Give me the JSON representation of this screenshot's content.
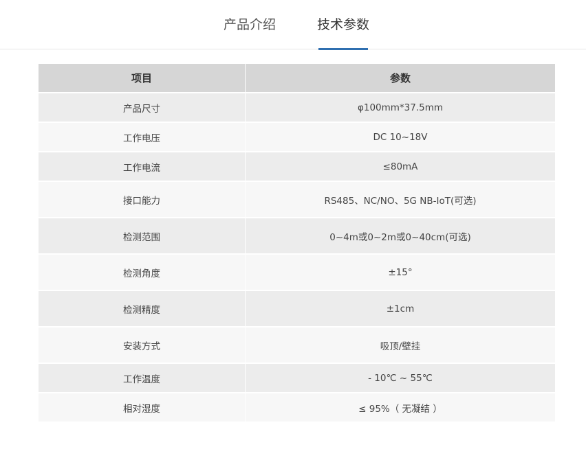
{
  "tabs": [
    {
      "label": "产品介绍",
      "active": false
    },
    {
      "label": "技术参数",
      "active": true
    }
  ],
  "accent_color": "#2f6fb0",
  "table": {
    "headers": [
      "项目",
      "参数"
    ],
    "rows": [
      {
        "item": "产品尺寸",
        "value": "φ100mm*37.5mm"
      },
      {
        "item": "工作电压",
        "value": "DC 10~18V"
      },
      {
        "item": "工作电流",
        "value": "≤80mA"
      },
      {
        "item": "接口能力",
        "value": "RS485、NC/NO、5G NB-IoT(可选)"
      },
      {
        "item": "检测范围",
        "value": "0~4m或0~2m或0~40cm(可选)"
      },
      {
        "item": "检测角度",
        "value": "±15°"
      },
      {
        "item": "检测精度",
        "value": "±1cm"
      },
      {
        "item": "安装方式",
        "value": "吸顶/壁挂"
      },
      {
        "item": "工作温度",
        "value": "- 10℃ ~ 55℃"
      },
      {
        "item": "相对湿度",
        "value": "≤ 95%（ 无凝结 ）"
      }
    ]
  }
}
